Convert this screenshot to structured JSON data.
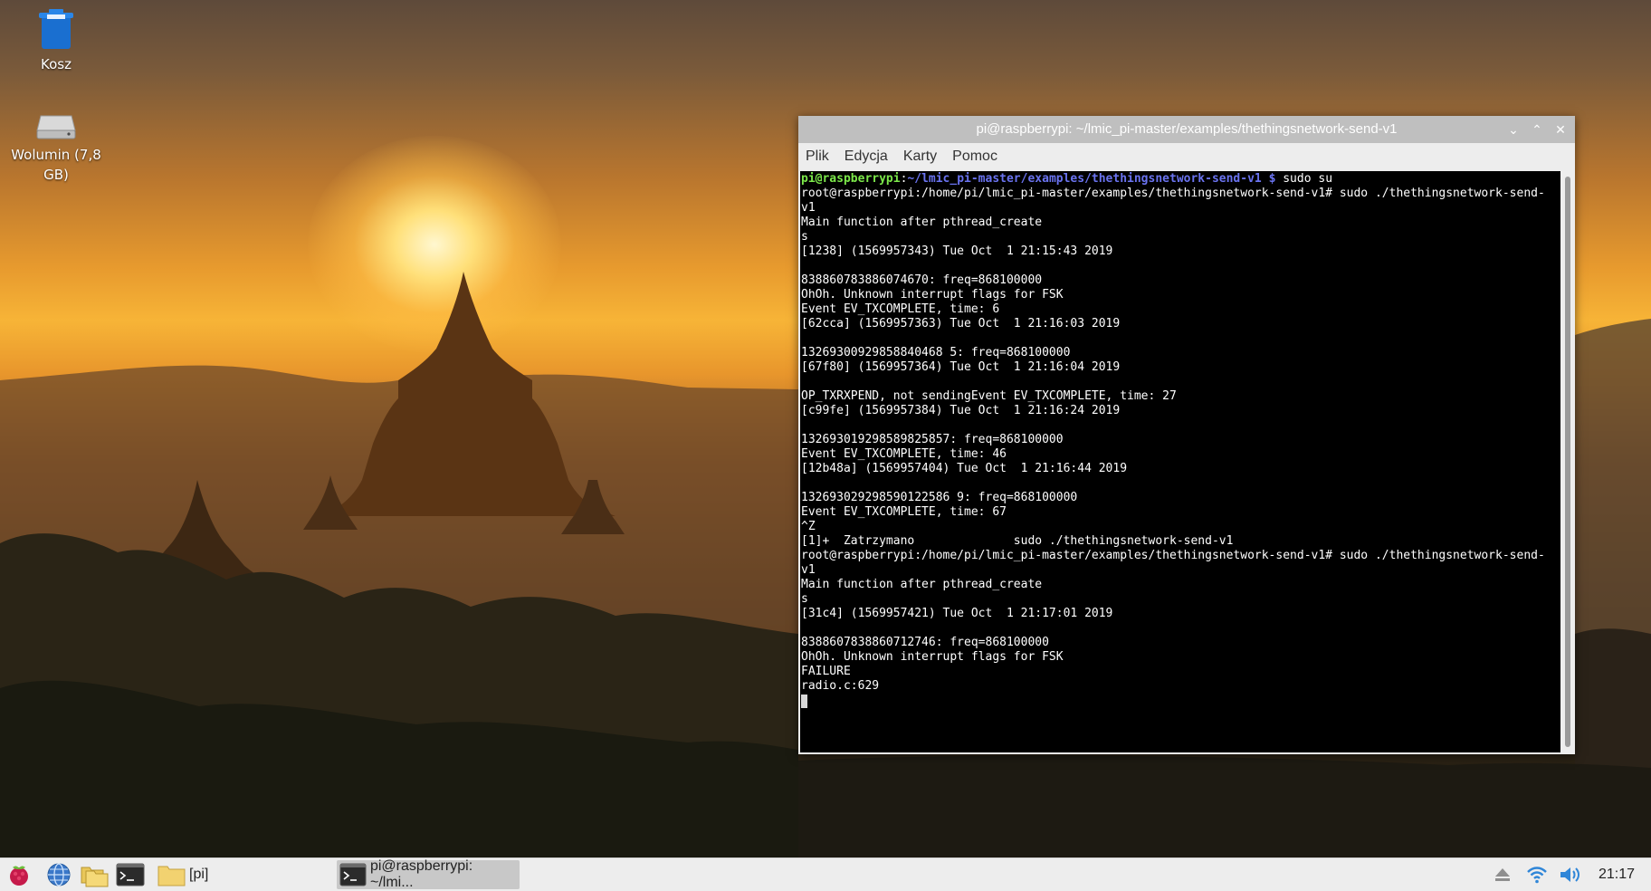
{
  "desktop": {
    "icons": [
      {
        "label": "Kosz",
        "icon": "trash-icon"
      },
      {
        "label": "Wolumin (7,8 GB)",
        "icon": "drive-icon"
      }
    ]
  },
  "terminal": {
    "title": "pi@raspberrypi: ~/lmic_pi-master/examples/thethingsnetwork-send-v1",
    "menu": [
      "Plik",
      "Edycja",
      "Karty",
      "Pomoc"
    ],
    "prompt": {
      "user": "pi@raspberrypi",
      "sep": ":",
      "path": "~/lmic_pi-master/examples/thethingsnetwork-send-v1 $",
      "command": " sudo su"
    },
    "lines": [
      "root@raspberrypi:/home/pi/lmic_pi-master/examples/thethingsnetwork-send-v1# sudo ./thethingsnetwork-send-",
      "v1",
      "Main function after pthread_create",
      "s",
      "[1238] (1569957343) Tue Oct  1 21:15:43 2019",
      "",
      "838860783886074670: freq=868100000",
      "OhOh. Unknown interrupt flags for FSK",
      "Event EV_TXCOMPLETE, time: 6",
      "[62cca] (1569957363) Tue Oct  1 21:16:03 2019",
      "",
      "13269300929858840468 5: freq=868100000",
      "[67f80] (1569957364) Tue Oct  1 21:16:04 2019",
      "",
      "OP_TXRXPEND, not sendingEvent EV_TXCOMPLETE, time: 27",
      "[c99fe] (1569957384) Tue Oct  1 21:16:24 2019",
      "",
      "132693019298589825857: freq=868100000",
      "Event EV_TXCOMPLETE, time: 46",
      "[12b48a] (1569957404) Tue Oct  1 21:16:44 2019",
      "",
      "132693029298590122586 9: freq=868100000",
      "Event EV_TXCOMPLETE, time: 67",
      "^Z",
      "[1]+  Zatrzymano              sudo ./thethingsnetwork-send-v1",
      "root@raspberrypi:/home/pi/lmic_pi-master/examples/thethingsnetwork-send-v1# sudo ./thethingsnetwork-send-",
      "v1",
      "Main function after pthread_create",
      "s",
      "[31c4] (1569957421) Tue Oct  1 21:17:01 2019",
      "",
      "8388607838860712746: freq=868100000",
      "OhOh. Unknown interrupt flags for FSK",
      "FAILURE",
      "radio.c:629"
    ]
  },
  "taskbar": {
    "folder_label": "[pi]",
    "task_label": "pi@raspberrypi: ~/lmi...",
    "clock": "21:17"
  },
  "colors": {
    "taskbar_bg": "#ededed",
    "titlebar_bg": "#bfbfbf",
    "prompt_user": "#7ce84a",
    "prompt_path": "#6a73f0"
  }
}
